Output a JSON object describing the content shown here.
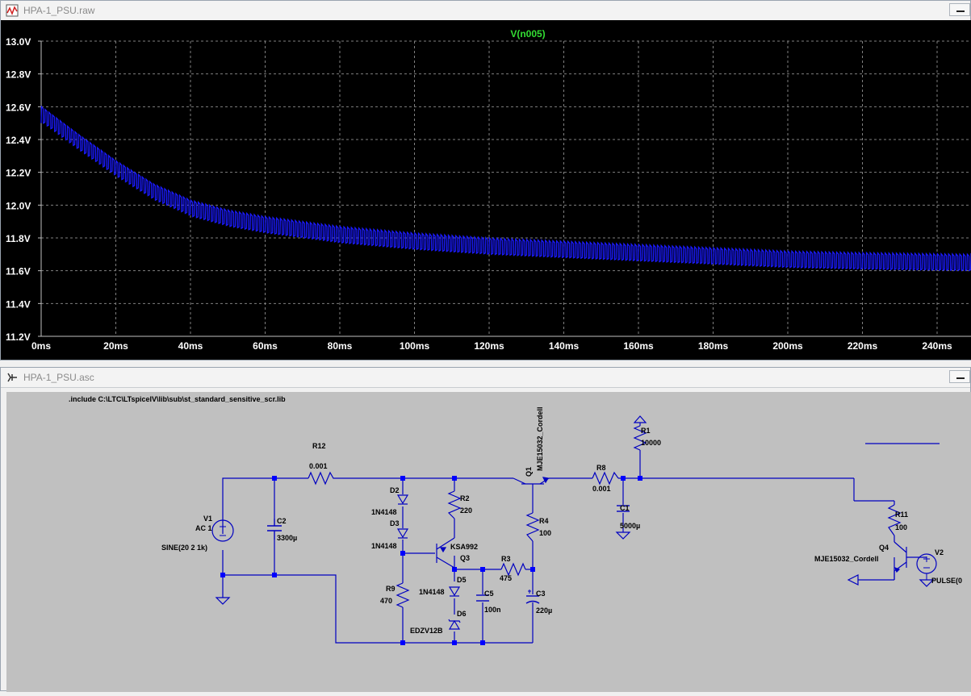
{
  "waveform_window": {
    "title": "HPA-1_PSU.raw",
    "trace_label": "V(n005)",
    "colors": {
      "background": "#000000",
      "grid": "#808080",
      "trace": "#1a1aff",
      "trace_label": "#33dd33",
      "tick_text": "#ffffff"
    }
  },
  "chart_data": {
    "type": "line",
    "title": "V(n005)",
    "xlabel": "",
    "ylabel": "",
    "xlim": [
      0,
      250
    ],
    "ylim": [
      11.2,
      13.0
    ],
    "x_ticks": [
      "0ms",
      "20ms",
      "40ms",
      "60ms",
      "80ms",
      "100ms",
      "120ms",
      "140ms",
      "160ms",
      "180ms",
      "200ms",
      "220ms",
      "240ms"
    ],
    "y_ticks": [
      "11.2V",
      "11.4V",
      "11.6V",
      "11.8V",
      "12.0V",
      "12.2V",
      "12.4V",
      "12.6V",
      "12.8V",
      "13.0V"
    ],
    "grid": true,
    "series": [
      {
        "name": "V(n005)",
        "ripple_period_ms": 1,
        "ripple_peak_to_peak_v": 0.1,
        "envelope_x": [
          0,
          10,
          20,
          30,
          40,
          50,
          60,
          80,
          100,
          120,
          140,
          160,
          180,
          200,
          220,
          250
        ],
        "envelope_y": [
          12.55,
          12.38,
          12.22,
          12.08,
          11.98,
          11.92,
          11.88,
          11.82,
          11.78,
          11.75,
          11.73,
          11.71,
          11.69,
          11.67,
          11.66,
          11.65
        ]
      }
    ]
  },
  "schematic_window": {
    "title": "HPA-1_PSU.asc",
    "directive": ".include C:\\LTC\\LTspiceIV\\lib\\sub\\st_standard_sensitive_scr.lib",
    "colors": {
      "background": "#c0c0c0",
      "wire": "#0000c0",
      "junction": "#0000ff",
      "text": "#000000"
    },
    "components": {
      "v1": {
        "name": "V1",
        "value": "AC 1",
        "extra": "SINE(20 2 1k)"
      },
      "c2": {
        "name": "C2",
        "value": "3300µ"
      },
      "r12": {
        "name": "R12",
        "value": "0.001"
      },
      "d2": {
        "name": "D2",
        "value": "1N4148"
      },
      "d3": {
        "name": "D3",
        "value": "1N4148"
      },
      "r9": {
        "name": "R9",
        "value": "470"
      },
      "r2": {
        "name": "R2",
        "value": "220"
      },
      "q3": {
        "name": "Q3",
        "value": "KSA992"
      },
      "d5": {
        "name": "D5",
        "value": "1N4148"
      },
      "d6": {
        "name": "D6",
        "value": "EDZV12B"
      },
      "c5": {
        "name": "C5",
        "value": "100n"
      },
      "r3": {
        "name": "R3",
        "value": "475"
      },
      "q1": {
        "name": "Q1",
        "value": "MJE15032_Cordell"
      },
      "r4": {
        "name": "R4",
        "value": "100"
      },
      "c3": {
        "name": "C3",
        "value": "220µ"
      },
      "r8": {
        "name": "R8",
        "value": "0.001"
      },
      "c1": {
        "name": "C1",
        "value": "5000µ"
      },
      "r1": {
        "name": "R1",
        "value": "10000"
      },
      "r11": {
        "name": "R11",
        "value": "100"
      },
      "q4": {
        "name": "Q4",
        "value": "MJE15032_Cordell"
      },
      "v2": {
        "name": "V2",
        "value": "PULSE(0"
      }
    }
  }
}
